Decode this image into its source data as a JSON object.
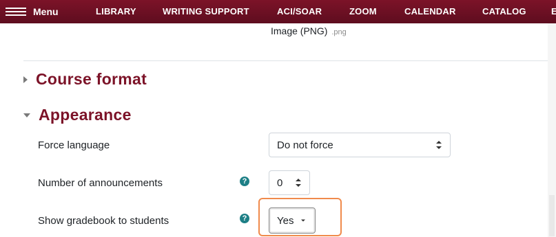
{
  "nav": {
    "menu_label": "Menu",
    "links": [
      "LIBRARY",
      "WRITING SUPPORT",
      "ACI/SOAR",
      "ZOOM",
      "CALENDAR",
      "CATALOG",
      "E"
    ]
  },
  "file_type": {
    "label": "Image (PNG)",
    "extension": ".png"
  },
  "sections": {
    "course_format": {
      "title": "Course format",
      "expanded": false
    },
    "appearance": {
      "title": "Appearance",
      "expanded": true
    }
  },
  "fields": {
    "force_language": {
      "label": "Force language",
      "value": "Do not force"
    },
    "announcements": {
      "label": "Number of announcements",
      "value": "0"
    },
    "gradebook": {
      "label": "Show gradebook to students",
      "value": "Yes"
    }
  },
  "colors": {
    "brand": "#7c1328",
    "help_icon": "#1d7f86",
    "focus_highlight": "#f08a4b"
  },
  "icons": {
    "help": "question-circle-icon",
    "menu": "hamburger-icon",
    "collapsed": "caret-right-icon",
    "expanded": "caret-down-icon"
  }
}
